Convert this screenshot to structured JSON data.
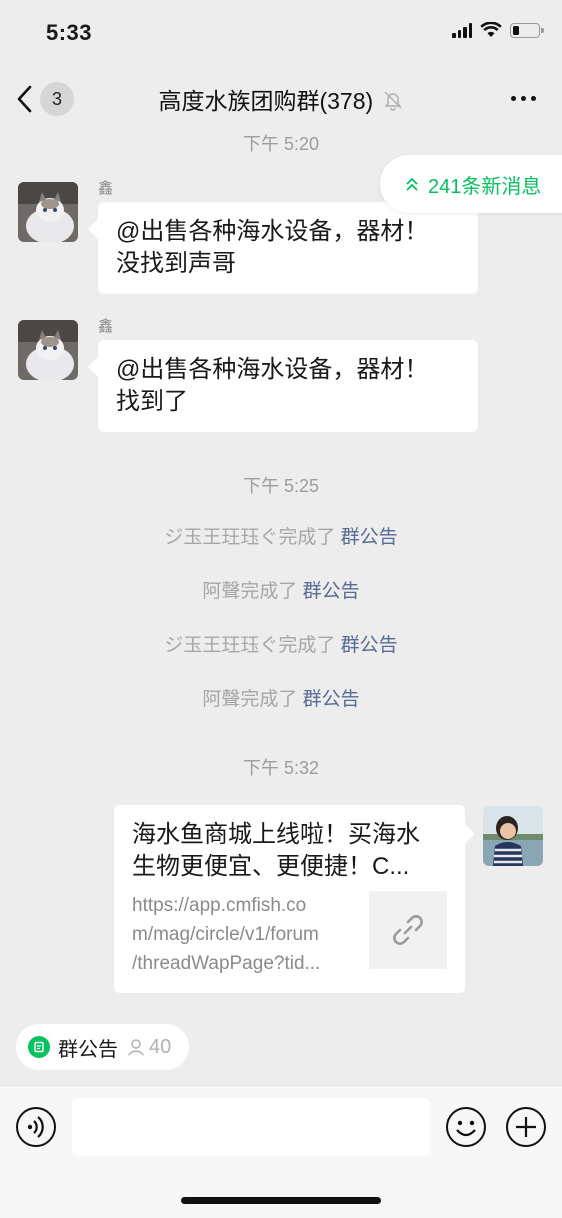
{
  "status_bar": {
    "time": "5:33",
    "battery_level": 0.25
  },
  "nav": {
    "unread_count": "3",
    "title": "高度水族团购群(378)",
    "muted": true
  },
  "new_messages": {
    "label": "241条新消息"
  },
  "messages": [
    {
      "type": "timestamp",
      "text": "下午 5:20"
    },
    {
      "type": "text",
      "sender": "鑫",
      "lines": [
        "@出售各种海水设备，器材！",
        "没找到声哥"
      ]
    },
    {
      "type": "text",
      "sender": "鑫",
      "lines": [
        "@出售各种海水设备，器材！",
        "找到了"
      ]
    },
    {
      "type": "timestamp",
      "text": "下午 5:25"
    },
    {
      "type": "system",
      "prefix": "ジ玉王玨珏ぐ完成了",
      "link": "群公告"
    },
    {
      "type": "system",
      "prefix": "阿聲完成了",
      "link": "群公告"
    },
    {
      "type": "system",
      "prefix": "ジ玉王玨珏ぐ完成了",
      "link": "群公告"
    },
    {
      "type": "system",
      "prefix": "阿聲完成了",
      "link": "群公告"
    },
    {
      "type": "timestamp",
      "text": "下午 5:32"
    },
    {
      "type": "link",
      "title_lines": [
        "海水鱼商城上线啦！买海水",
        "生物更便宜、更便捷！C..."
      ],
      "desc_lines": [
        "https://app.cmfish.co",
        "m/mag/circle/v1/forum",
        "/threadWapPage?tid..."
      ]
    }
  ],
  "notice_chip": {
    "label": "群公告",
    "count": "40"
  },
  "input": {
    "placeholder": ""
  },
  "colors": {
    "accent": "#07c160",
    "link": "#576b95",
    "background": "#ededed"
  }
}
